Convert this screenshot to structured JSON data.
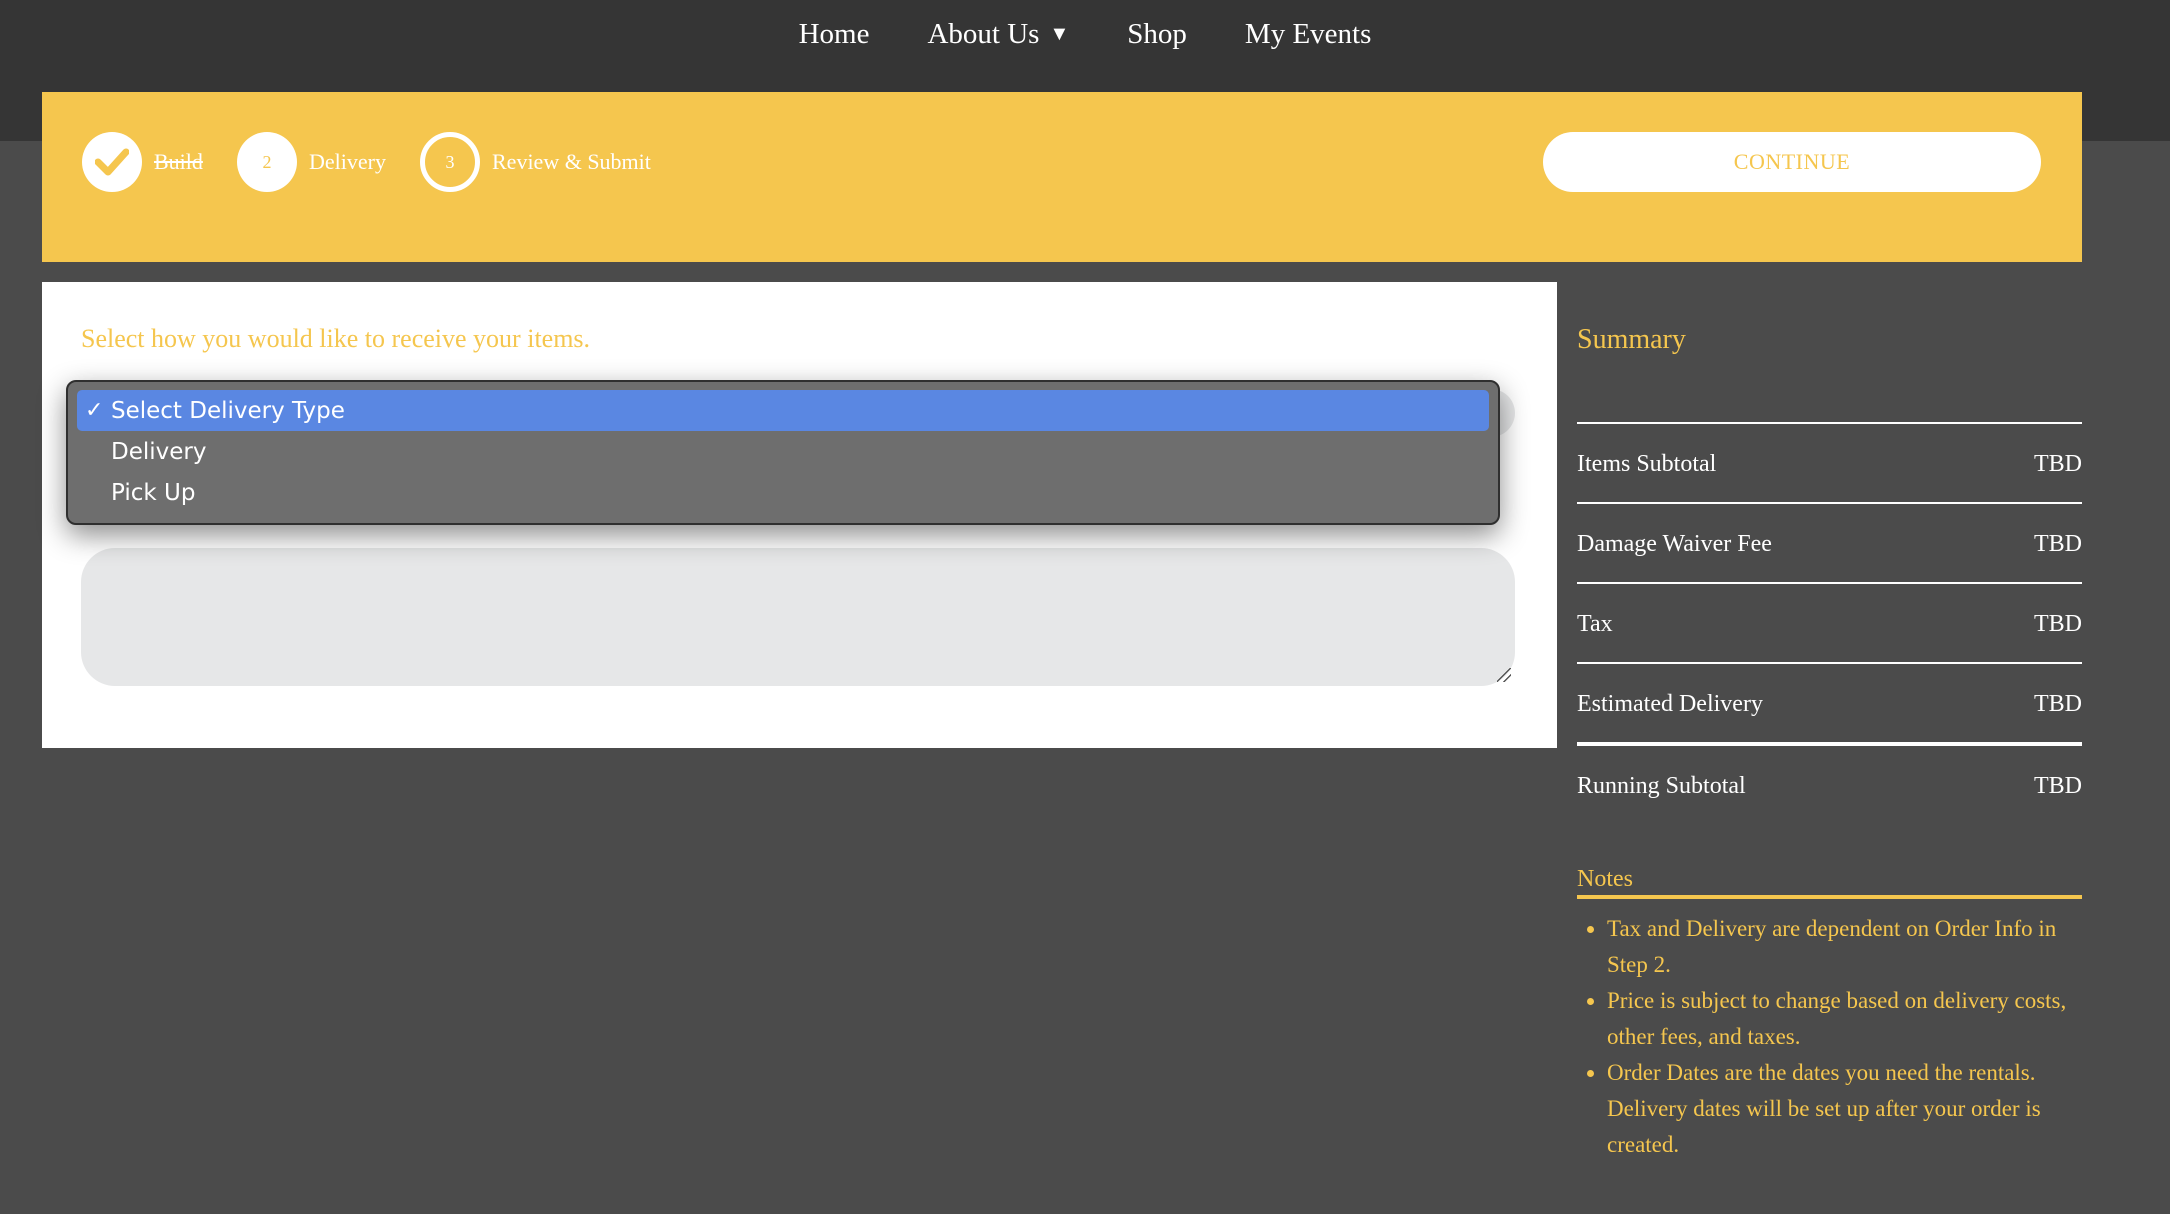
{
  "nav": {
    "items": [
      {
        "label": "Home"
      },
      {
        "label": "About Us",
        "has_dropdown": true
      },
      {
        "label": "Shop"
      },
      {
        "label": "My Events"
      }
    ]
  },
  "steps": [
    {
      "number": "",
      "label": "Build",
      "state": "complete"
    },
    {
      "number": "2",
      "label": "Delivery",
      "state": "current"
    },
    {
      "number": "3",
      "label": "Review & Submit",
      "state": "upcoming"
    }
  ],
  "continue_label": "CONTINUE",
  "main": {
    "instruction": "Select how you would like to receive your items.",
    "delivery_select": {
      "options": [
        "Select Delivery Type",
        "Delivery",
        "Pick Up"
      ],
      "selected_index": 0
    }
  },
  "summary": {
    "title": "Summary",
    "rows": [
      {
        "label": "Items Subtotal",
        "value": "TBD"
      },
      {
        "label": "Damage Waiver Fee",
        "value": "TBD"
      },
      {
        "label": "Tax",
        "value": "TBD"
      },
      {
        "label": "Estimated Delivery",
        "value": "TBD"
      },
      {
        "label": "Running Subtotal",
        "value": "TBD"
      }
    ]
  },
  "notes": {
    "title": "Notes",
    "items": [
      "Tax and Delivery are dependent on Order Info in Step 2.",
      "Price is subject to change based on delivery costs, other fees, and taxes.",
      "Order Dates are the dates you need the rentals. Delivery dates will be set up after your order is created."
    ]
  },
  "colors": {
    "accent": "#f5c64e",
    "nav_bg": "#353535",
    "page_bg": "#4b4b4b",
    "option_highlight": "#5a87e2"
  }
}
